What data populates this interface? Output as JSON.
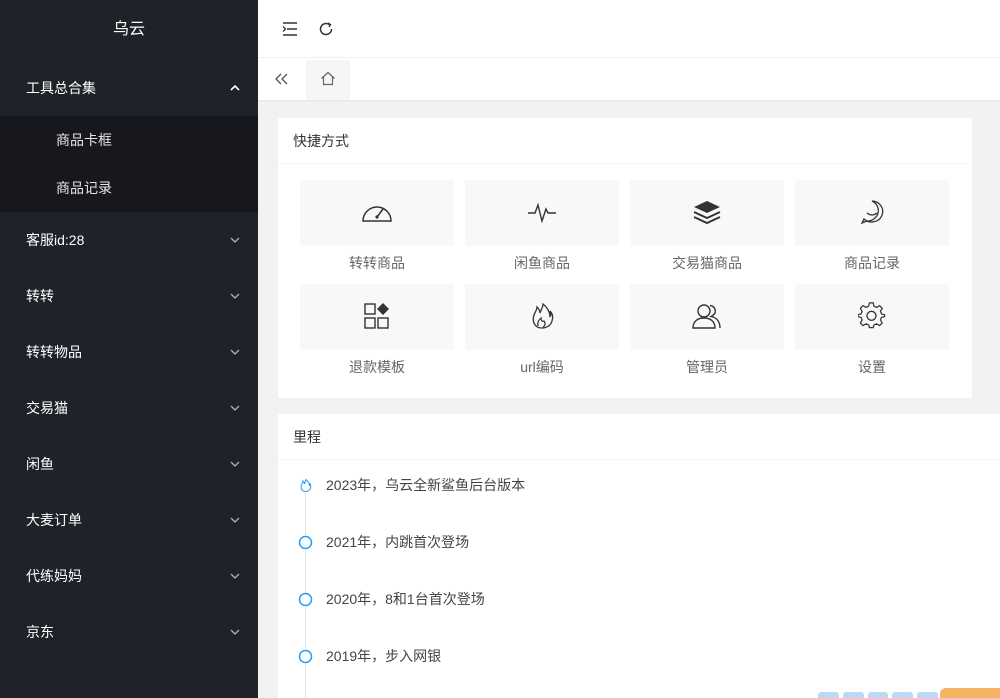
{
  "app": {
    "title": "乌云"
  },
  "sidebar": {
    "groups": [
      {
        "label": "工具总合集",
        "expanded": true,
        "children": [
          "商品卡框",
          "商品记录"
        ]
      },
      {
        "label": "客服id:28"
      },
      {
        "label": "转转"
      },
      {
        "label": "转转物品"
      },
      {
        "label": "交易猫"
      },
      {
        "label": "闲鱼"
      },
      {
        "label": "大麦订单"
      },
      {
        "label": "代练妈妈"
      },
      {
        "label": "京东"
      }
    ]
  },
  "topbar": {
    "icons": [
      "menu-fold-icon",
      "refresh-icon"
    ]
  },
  "tabs": {
    "icons": [
      "double-chevron-left-icon",
      "home-icon"
    ]
  },
  "shortcuts": {
    "title": "快捷方式",
    "items": [
      {
        "label": "转转商品",
        "icon": "dashboard-icon"
      },
      {
        "label": "闲鱼商品",
        "icon": "pulse-icon"
      },
      {
        "label": "交易猫商品",
        "icon": "layers-icon"
      },
      {
        "label": "商品记录",
        "icon": "chat-bubble-icon"
      },
      {
        "label": "退款模板",
        "icon": "template-icon"
      },
      {
        "label": "url编码",
        "icon": "fire-icon"
      },
      {
        "label": "管理员",
        "icon": "users-icon"
      },
      {
        "label": "设置",
        "icon": "gear-icon"
      }
    ]
  },
  "milestones": {
    "title": "里程",
    "items": [
      {
        "text": "2023年，乌云全新鲨鱼后台版本",
        "icon": "fire-icon"
      },
      {
        "text": "2021年，内跳首次登场",
        "icon": "circle-icon"
      },
      {
        "text": "2020年，8和1台首次登场",
        "icon": "circle-icon"
      },
      {
        "text": "2019年，步入网银",
        "icon": "circle-icon"
      }
    ]
  },
  "colors": {
    "sidebar_bg": "#20222a",
    "submenu_bg": "#17181d",
    "accent": "#1e9fff"
  }
}
